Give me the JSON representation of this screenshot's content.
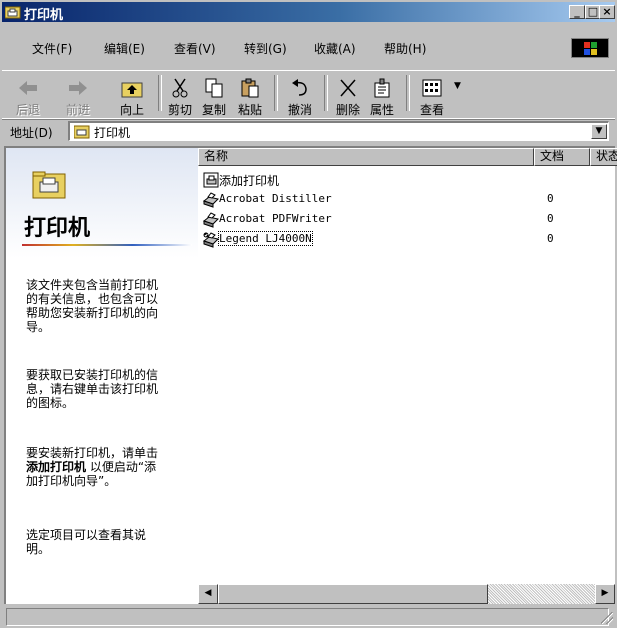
{
  "window": {
    "title": "打印机",
    "title_icon": "printer-folder-icon",
    "minimize": "_",
    "maximize": "□",
    "close": "×"
  },
  "menu": {
    "items": [
      {
        "label": "文件(F)"
      },
      {
        "label": "编辑(E)"
      },
      {
        "label": "查看(V)"
      },
      {
        "label": "转到(G)"
      },
      {
        "label": "收藏(A)"
      },
      {
        "label": "帮助(H)"
      }
    ]
  },
  "toolbar": {
    "back": "后退",
    "forward": "前进",
    "up": "向上",
    "cut": "剪切",
    "copy": "复制",
    "paste": "粘贴",
    "undo": "撤消",
    "delete": "删除",
    "properties": "属性",
    "views": "查看"
  },
  "address": {
    "label": "地址(D)",
    "value": "打印机"
  },
  "left_panel": {
    "title": "打印机",
    "para1": "该文件夹包含当前打印机的有关信息，也包含可以帮助您安装新打印机的向导。",
    "para2": "要获取已安装打印机的信息，请右键单击该打印机的图标。",
    "para3_pre": "要安装新打印机，请单击",
    "para3_bold": "添加打印机",
    "para3_post": "以便启动“添加打印机向导”。",
    "para4": "选定项目可以查看其说明。"
  },
  "listview": {
    "columns": {
      "name": "名称",
      "docs": "文档",
      "status": "状态"
    },
    "rows": [
      {
        "name": "添加打印机",
        "docs": "",
        "icon": "add-printer-icon"
      },
      {
        "name": "Acrobat Distiller",
        "docs": "0",
        "icon": "printer-icon"
      },
      {
        "name": "Acrobat PDFWriter",
        "docs": "0",
        "icon": "printer-icon"
      },
      {
        "name": "Legend LJ4000N",
        "docs": "0",
        "icon": "default-printer-icon"
      }
    ]
  },
  "colors": {
    "title_start": "#08246b",
    "title_end": "#a6caf0",
    "face": "#c0c0c0"
  }
}
